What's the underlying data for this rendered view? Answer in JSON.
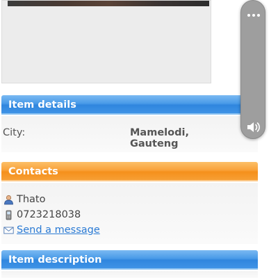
{
  "item_details": {
    "header": "Item details",
    "city_label": "City:",
    "city_value": "Mamelodi, Gauteng"
  },
  "contacts": {
    "header": "Contacts",
    "name": "Thato",
    "phone": "0723218038",
    "message_link": "Send a message"
  },
  "item_description": {
    "header": "Item description"
  },
  "icons": {
    "user": "user-icon",
    "phone": "mobile-phone-icon",
    "mail": "envelope-icon",
    "more": "more-dots-icon",
    "volume": "volume-icon"
  },
  "colors": {
    "blue_header": "#3f93e6",
    "orange_header": "#f79f34",
    "link": "#2a7ad4",
    "overlay_control": "#9e9e9e"
  }
}
